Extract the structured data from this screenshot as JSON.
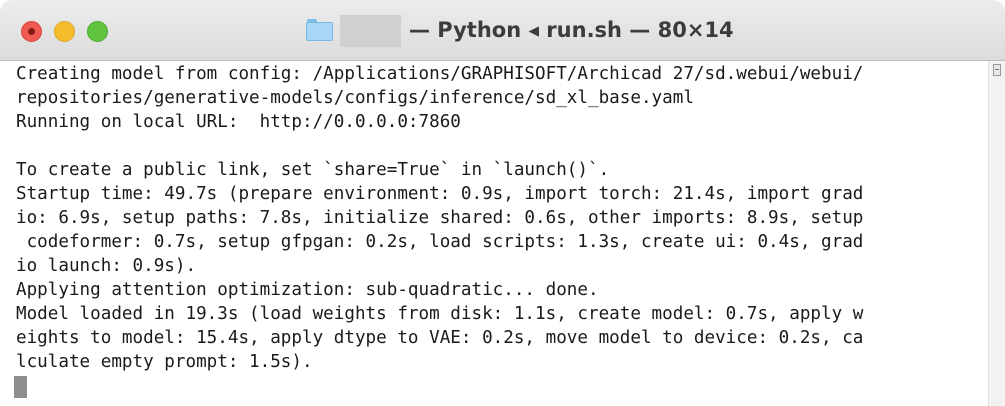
{
  "window": {
    "title": "— Python ◂ run.sh — 80×14"
  },
  "terminal": {
    "lines": [
      "Creating model from config: /Applications/GRAPHISOFT/Archicad 27/sd.webui/webui/",
      "repositories/generative-models/configs/inference/sd_xl_base.yaml",
      "Running on local URL:  http://0.0.0.0:7860",
      "",
      "To create a public link, set `share=True` in `launch()`.",
      "Startup time: 49.7s (prepare environment: 0.9s, import torch: 21.4s, import grad",
      "io: 6.9s, setup paths: 7.8s, initialize shared: 0.6s, other imports: 8.9s, setup",
      " codeformer: 0.7s, setup gfpgan: 0.2s, load scripts: 1.3s, create ui: 0.4s, grad",
      "io launch: 0.9s).",
      "Applying attention optimization: sub-quadratic... done.",
      "Model loaded in 19.3s (load weights from disk: 1.1s, create model: 0.7s, apply w",
      "eights to model: 15.4s, apply dtype to VAE: 0.2s, move model to device: 0.2s, ca",
      "lculate empty prompt: 1.5s)."
    ]
  },
  "colors": {
    "close": "#ee5a52",
    "minimize": "#f5bd2e",
    "zoom": "#60c440",
    "text": "#1a1a1a",
    "cursor": "#8e8e8e"
  },
  "icons": {
    "titlebar": "folder-icon"
  }
}
